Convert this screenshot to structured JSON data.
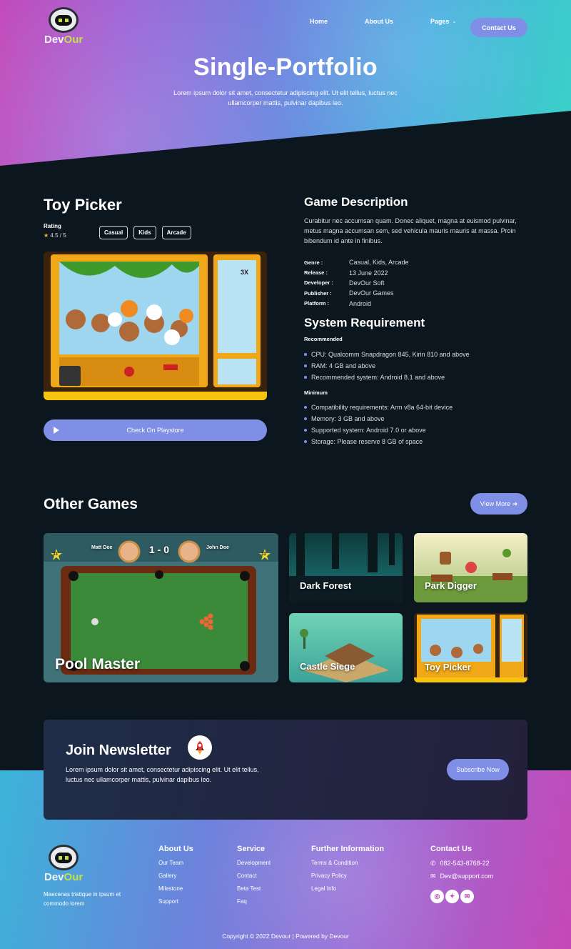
{
  "brand": {
    "name_a": "Dev",
    "name_b": "Our"
  },
  "nav": {
    "items": [
      "Home",
      "About Us",
      "Pages"
    ],
    "cta": "Contact Us"
  },
  "hero": {
    "title": "Single-Portfolio",
    "subtitle": "Lorem ipsum dolor sit amet, consectetur adipiscing elit. Ut elit tellus, luctus nec ullamcorper mattis, pulvinar dapibus leo."
  },
  "game": {
    "title": "Toy Picker",
    "rating_label": "Rating",
    "rating_value": "4.5 / 5",
    "tags": [
      "Casual",
      "Kids",
      "Arcade"
    ],
    "play_button": "Check On Playstore"
  },
  "description": {
    "heading": "Game Description",
    "text": "Curabitur nec accumsan quam. Donec aliquet, magna at euismod pulvinar, metus magna accumsan sem, sed vehicula mauris mauris at massa. Proin bibendum id ante in finibus.",
    "specs": [
      {
        "k": "Genre :",
        "v": "Casual, Kids, Arcade"
      },
      {
        "k": "Release :",
        "v": "13 June 2022"
      },
      {
        "k": "Developer :",
        "v": "DevOur Soft"
      },
      {
        "k": "Publisher :",
        "v": "DevOur Games"
      },
      {
        "k": "Platform :",
        "v": "Android"
      }
    ]
  },
  "system": {
    "heading": "System Requirement",
    "recommended_label": "Recommended",
    "recommended": [
      "CPU: Qualcomm Snapdragon 845, Kirin 810 and above",
      "RAM: 4 GB and above",
      "Recommended system: Android 8.1 and above"
    ],
    "minimum_label": "Minimum",
    "minimum": [
      "Compatibility requirements: Arm v8a 64-bit device",
      "Memory: 3 GB and above",
      "Supported system: Android 7.0 or above",
      "Storage: Please reserve 8 GB of space"
    ]
  },
  "other": {
    "heading": "Other Games",
    "view_more": "View More ➔",
    "pool": {
      "title": "Pool Master",
      "p1": "Matt Doe",
      "p2": "John Doe",
      "score": "1 - 0",
      "level1": "33",
      "level2": "33"
    },
    "games": [
      "Dark Forest",
      "Park Digger",
      "Castle Siege",
      "Toy Picker"
    ],
    "toy_multiplier": "3X"
  },
  "newsletter": {
    "title": "Join Newsletter",
    "text": "Lorem ipsum dolor sit amet, consectetur adipiscing elit. Ut elit tellus, luctus nec ullamcorper mattis, pulvinar dapibus leo.",
    "button": "Subscribe Now"
  },
  "footer": {
    "tagline": "Maecenas tristique in ipsum et commodo lorem",
    "about": {
      "h": "About Us",
      "items": [
        "Our Team",
        "Gallery",
        "Milestone",
        "Support"
      ]
    },
    "service": {
      "h": "Service",
      "items": [
        "Development",
        "Contact",
        "Beta Test",
        "Faq"
      ]
    },
    "further": {
      "h": "Further Information",
      "items": [
        "Terms & Condition",
        "Privacy Policy",
        "Legal Info"
      ]
    },
    "contact": {
      "h": "Contact Us",
      "phone": "082-543-8768-22",
      "email": "Dev@support.com"
    },
    "copyright": "Copyright © 2022 Devour | Powered by Devour"
  },
  "colors": {
    "accent": "#7f8fe6",
    "bg": "#0b161e",
    "green": "#c6e04a"
  }
}
